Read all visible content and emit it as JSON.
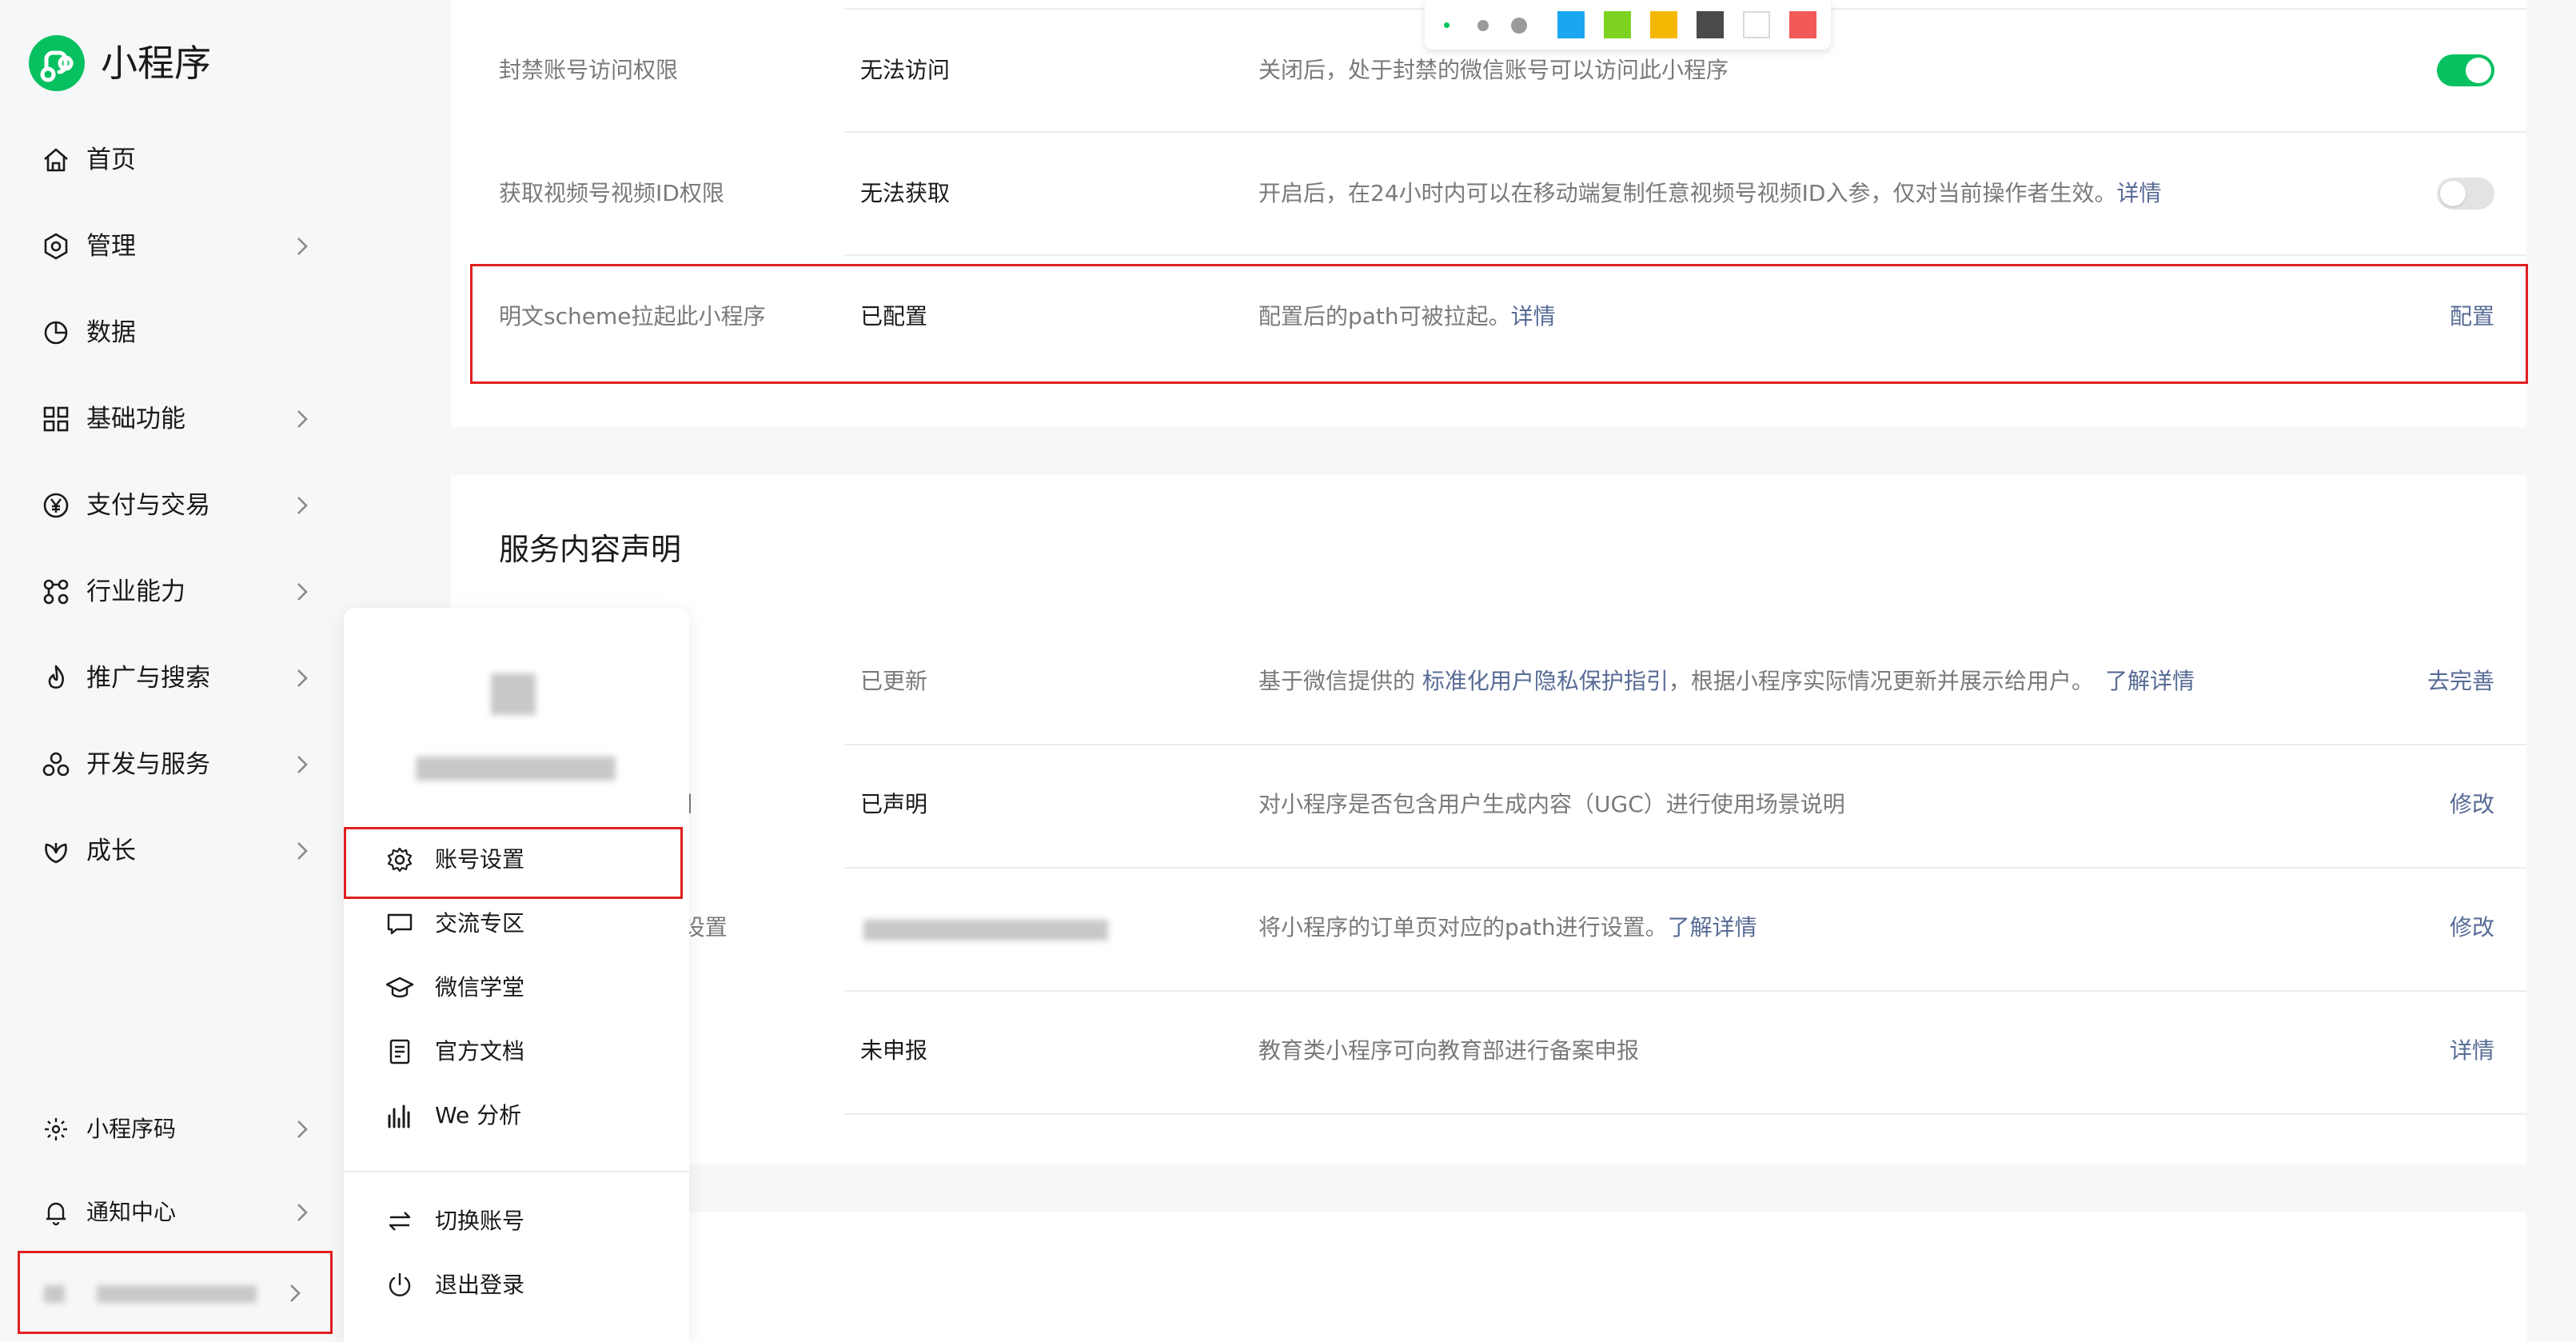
{
  "app": {
    "name": "小程序",
    "brand_color": "#07c160",
    "highlight_color": "#e02020",
    "link_color": "#576b95"
  },
  "sidebar": {
    "items": [
      {
        "label": "首页",
        "icon": "home-icon"
      },
      {
        "label": "管理",
        "icon": "manage-icon"
      },
      {
        "label": "数据",
        "icon": "data-icon"
      },
      {
        "label": "基础功能",
        "icon": "grid-icon"
      },
      {
        "label": "支付与交易",
        "icon": "yuan-icon"
      },
      {
        "label": "行业能力",
        "icon": "industry-icon"
      },
      {
        "label": "推广与搜索",
        "icon": "promote-icon"
      },
      {
        "label": "开发与服务",
        "icon": "develop-icon"
      },
      {
        "label": "成长",
        "icon": "growth-icon"
      }
    ],
    "bottom_items": [
      {
        "label": "小程序码",
        "icon": "qrcode-icon"
      },
      {
        "label": "通知中心",
        "icon": "bell-icon"
      }
    ]
  },
  "settings_top": {
    "rows": [
      {
        "name": "封禁账号访问权限",
        "value": "无法访问",
        "desc": "关闭后，处于封禁的微信账号可以访问此小程序",
        "control": "toggle-on"
      },
      {
        "name": "获取视频号视频ID权限",
        "value": "无法获取",
        "desc": "开启后，在24小时内可以在移动端复制任意视频号视频ID入参，仅对当前操作者生效。",
        "link": "详情",
        "control": "toggle-off"
      },
      {
        "name": "明文scheme拉起此小程序",
        "value": "已配置",
        "desc": "配置后的path可被拉起。",
        "link": "详情",
        "action": "配置"
      }
    ]
  },
  "service_section": {
    "title": "服务内容声明",
    "rows": [
      {
        "name": "",
        "value": "已更新",
        "desc_pre": "基于微信提供的 ",
        "desc_link": "标准化用户隐私保护指引",
        "desc_post": "，根据小程序实际情况更新并展示给用户。",
        "link": "了解详情",
        "action": "去完善"
      },
      {
        "name": "声明",
        "value": "已声明",
        "desc": "对小程序是否包含用户生成内容（UGC）进行使用场景说明",
        "action": "修改"
      },
      {
        "name": "h设置",
        "value": "",
        "desc": "将小程序的订单页对应的path进行设置。",
        "link": "了解详情",
        "action": "修改"
      },
      {
        "name": "",
        "value": "未申报",
        "desc": "教育类小程序可向教育部进行备案申报",
        "action": "详情"
      }
    ]
  },
  "color_toolbar": {
    "dot_sizes": [
      "small",
      "medium",
      "large"
    ],
    "swatches": [
      "#1aa7f0",
      "#7ed321",
      "#f5b800",
      "#4a4a4a",
      "#ffffff",
      "#f25a5a"
    ]
  },
  "account_menu": {
    "items": [
      {
        "label": "账号设置",
        "icon": "gear-icon"
      },
      {
        "label": "交流专区",
        "icon": "chat-icon"
      },
      {
        "label": "微信学堂",
        "icon": "graduation-cap-icon"
      },
      {
        "label": "官方文档",
        "icon": "document-icon"
      },
      {
        "label": "We 分析",
        "icon": "analytics-icon"
      }
    ],
    "bottom_items": [
      {
        "label": "切换账号",
        "icon": "switch-icon"
      },
      {
        "label": "退出登录",
        "icon": "power-icon"
      }
    ]
  }
}
